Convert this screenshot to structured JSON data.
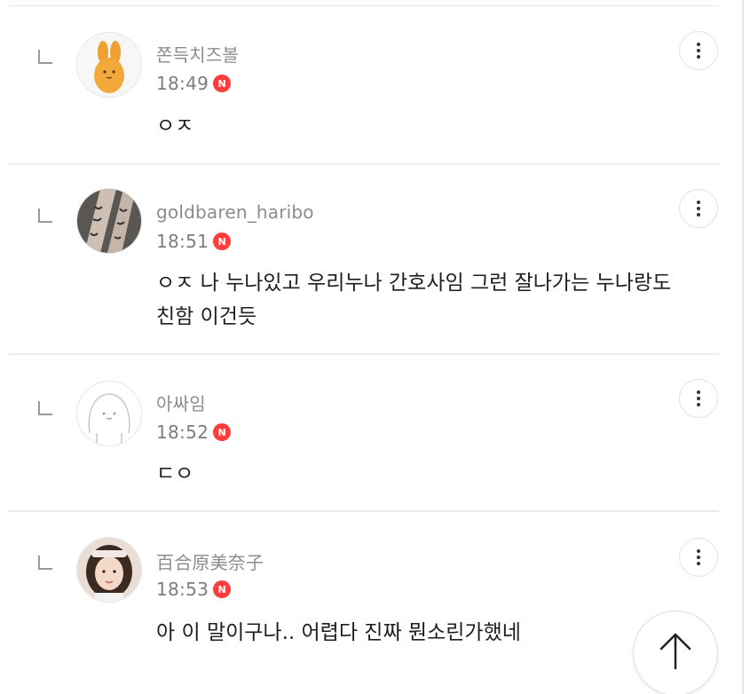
{
  "comments": [
    {
      "nickname": "쫀득치즈볼",
      "time": "18:49",
      "badge": "N",
      "text": "ㅇㅈ",
      "avatar_icon": "orange-bunny-plush-icon"
    },
    {
      "nickname": "goldbaren_haribo",
      "time": "18:51",
      "badge": "N",
      "text": "ㅇㅈ 나 누나있고 우리누나 간호사임 그런 잘나가는 누나랑도 친함 이건듯",
      "avatar_icon": "tattooed-arm-photo-icon"
    },
    {
      "nickname": "아싸임",
      "time": "18:52",
      "badge": "N",
      "text": "ㄷㅇ",
      "avatar_icon": "default-face-avatar-icon"
    },
    {
      "nickname": "百合原美奈子",
      "time": "18:53",
      "badge": "N",
      "text": "아 이 말이구나.. 어렵다 진짜 뭔소린가했네",
      "avatar_icon": "girl-portrait-photo-icon"
    }
  ],
  "icons": {
    "reply": "reply-corner-icon",
    "more": "more-vertical-icon",
    "scroll_top": "arrow-up-icon"
  },
  "colors": {
    "badge": "#ff3b3b",
    "nickname": "#8c8c8c",
    "text": "#1e1e1e"
  }
}
